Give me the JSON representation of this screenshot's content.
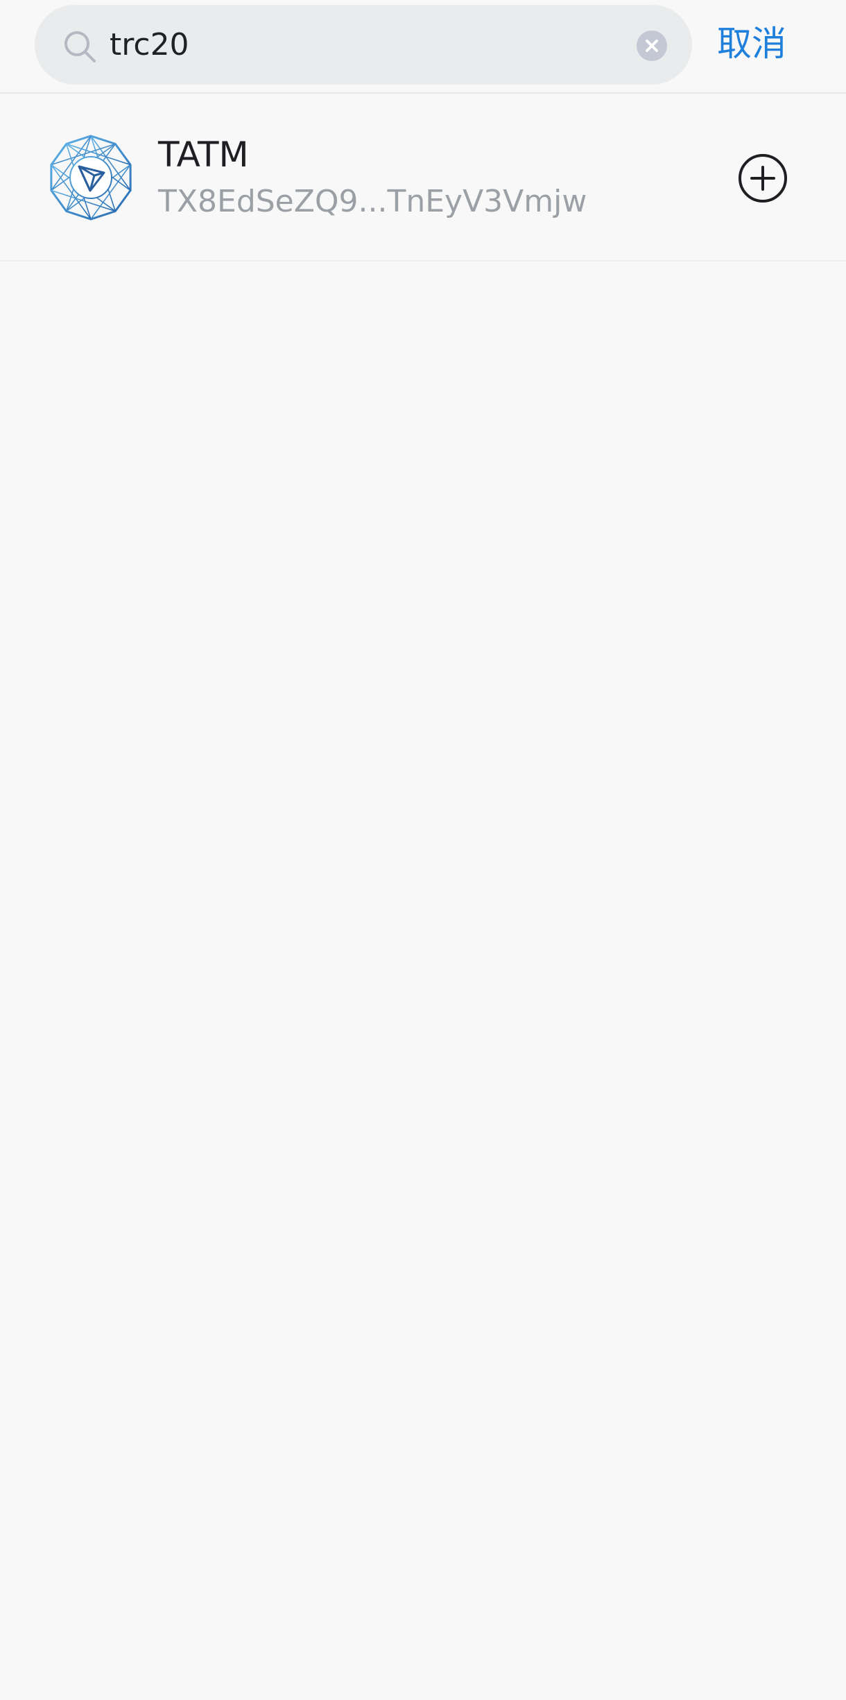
{
  "search": {
    "value": "trc20",
    "icon": "search-icon",
    "clear_icon": "close-icon"
  },
  "header": {
    "cancel_label": "取消"
  },
  "results": [
    {
      "name": "TATM",
      "address": "TX8EdSeZQ9...TnEyV3Vmjw",
      "logo_icon": "tron-token-logo-icon",
      "action_icon": "plus-circle-icon"
    }
  ],
  "colors": {
    "accent": "#1f7fdc",
    "background": "#f8f8f8",
    "search_bg": "#e9ebec",
    "muted_text": "#9ba0a7",
    "logo_blue": "#2f7fc1"
  }
}
